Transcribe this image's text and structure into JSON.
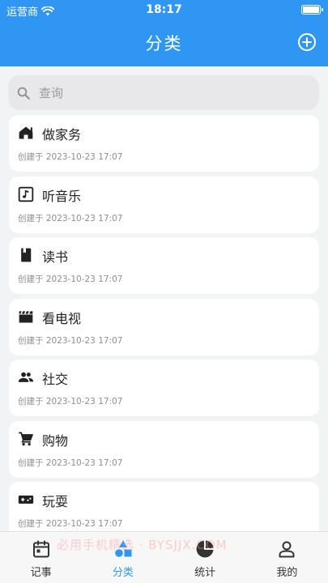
{
  "status_bar": {
    "carrier": "运营商",
    "time": "18:17"
  },
  "header": {
    "title": "分类"
  },
  "search": {
    "placeholder": "查询"
  },
  "categories": [
    {
      "name": "做家务",
      "created": "创建于 2023-10-23 17:07",
      "icon": "house-icon"
    },
    {
      "name": "听音乐",
      "created": "创建于 2023-10-23 17:07",
      "icon": "music-icon"
    },
    {
      "name": "读书",
      "created": "创建于 2023-10-23 17:07",
      "icon": "book-icon"
    },
    {
      "name": "看电视",
      "created": "创建于 2023-10-23 17:07",
      "icon": "clapperboard-icon"
    },
    {
      "name": "社交",
      "created": "创建于 2023-10-23 17:07",
      "icon": "people-icon"
    },
    {
      "name": "购物",
      "created": "创建于 2023-10-23 17:07",
      "icon": "cart-icon"
    },
    {
      "name": "玩耍",
      "created": "创建于 2023-10-23 17:07",
      "icon": "gamepad-icon"
    }
  ],
  "tabbar": {
    "items": [
      {
        "label": "记事",
        "icon": "calendar-icon"
      },
      {
        "label": "分类",
        "icon": "shapes-icon",
        "active": true
      },
      {
        "label": "统计",
        "icon": "pie-chart-icon"
      },
      {
        "label": "我的",
        "icon": "person-icon"
      }
    ]
  },
  "watermark": "必用手机精选 · BYSJJX.COM",
  "colors": {
    "accent": "#2f97f3",
    "background": "#f2f3f5",
    "card": "#ffffff"
  }
}
